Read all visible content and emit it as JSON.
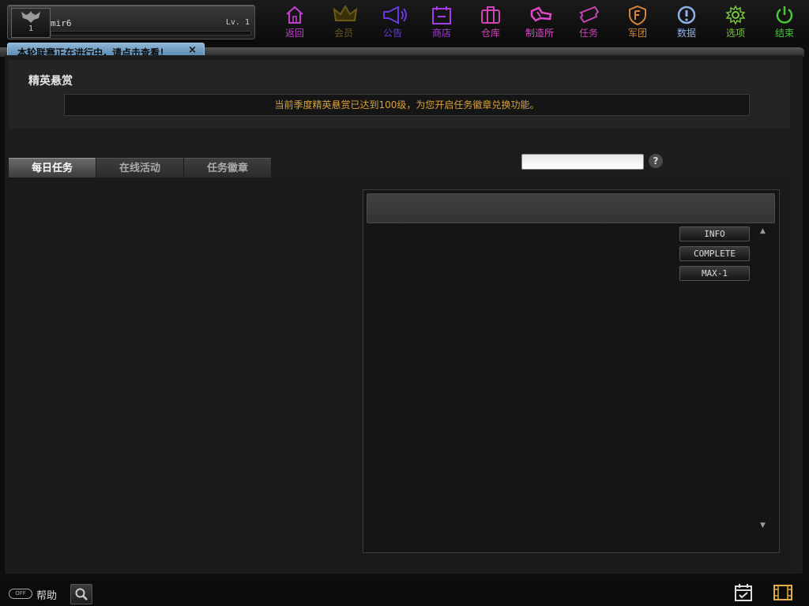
{
  "player": {
    "name": "mir6",
    "level_text": "Lv. 1",
    "avatar_level": "1",
    "xp_progress": 0.0
  },
  "nav": [
    {
      "label": "返回",
      "icon": "home-icon",
      "color": "#c43fd0"
    },
    {
      "label": "会员",
      "icon": "crown-icon",
      "color": "#6b5a18"
    },
    {
      "label": "公告",
      "icon": "megaphone-icon",
      "color": "#6a3ad8"
    },
    {
      "label": "商店",
      "icon": "shop-icon",
      "color": "#a43ce8"
    },
    {
      "label": "仓库",
      "icon": "briefcase-icon",
      "color": "#d044b6"
    },
    {
      "label": "制造所",
      "icon": "craft-icon",
      "color": "#e048c8"
    },
    {
      "label": "任务",
      "icon": "ticket-icon",
      "color": "#c844b4"
    },
    {
      "label": "军团",
      "icon": "shield-icon",
      "color": "#d6843a"
    },
    {
      "label": "数据",
      "icon": "info-icon",
      "color": "#8fb0e8"
    },
    {
      "label": "选项",
      "icon": "gear-icon",
      "color": "#78c83a"
    },
    {
      "label": "结束",
      "icon": "power-icon",
      "color": "#48c83a"
    }
  ],
  "announcement": {
    "text": "本轮联赛正在进行中，请点击查看！",
    "close": "×"
  },
  "bounty": {
    "title": "精英悬赏",
    "message": "当前季度精英悬赏已达到100级，为您开启任务徽章兑换功能。"
  },
  "tabs": [
    {
      "label": "每日任务",
      "active": true
    },
    {
      "label": "在线活动",
      "active": false
    },
    {
      "label": "任务徽章",
      "active": false
    }
  ],
  "search": {
    "value": "",
    "help": "?"
  },
  "debug_buttons": [
    "INFO",
    "COMPLETE",
    "MAX-1"
  ],
  "scroll": {
    "up": "▲",
    "down": "▼"
  },
  "footer": {
    "help_badge": "OFF",
    "help_label": "帮助"
  }
}
